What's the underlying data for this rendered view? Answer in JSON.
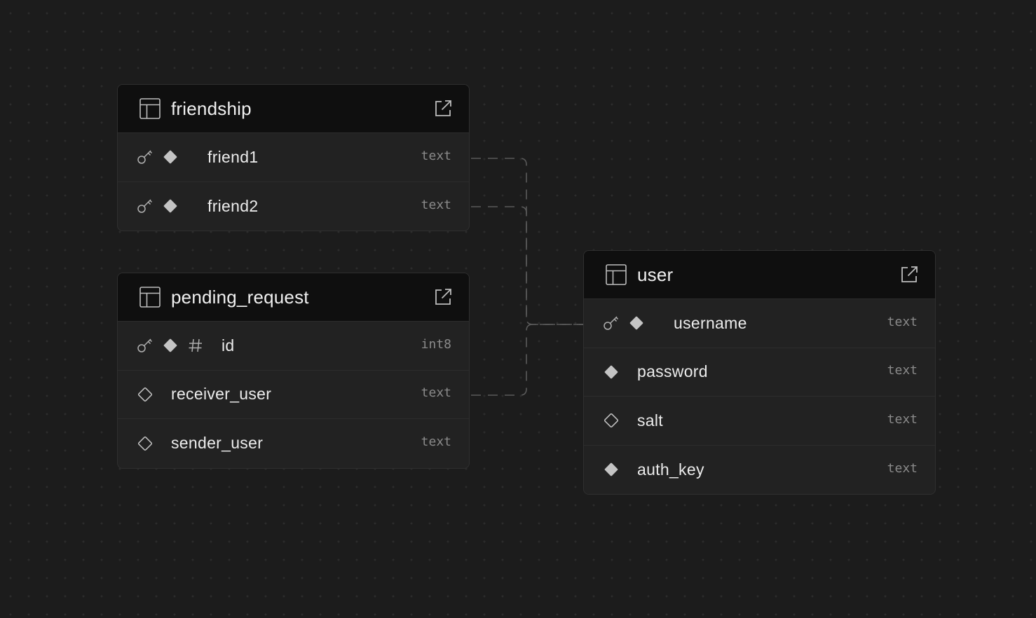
{
  "tables": {
    "friendship": {
      "name": "friendship",
      "columns": [
        {
          "name": "friend1",
          "type": "text"
        },
        {
          "name": "friend2",
          "type": "text"
        }
      ]
    },
    "pending_request": {
      "name": "pending_request",
      "columns": [
        {
          "name": "id",
          "type": "int8"
        },
        {
          "name": "receiver_user",
          "type": "text"
        },
        {
          "name": "sender_user",
          "type": "text"
        }
      ]
    },
    "user": {
      "name": "user",
      "columns": [
        {
          "name": "username",
          "type": "text"
        },
        {
          "name": "password",
          "type": "text"
        },
        {
          "name": "salt",
          "type": "text"
        },
        {
          "name": "auth_key",
          "type": "text"
        }
      ]
    }
  },
  "relations": [
    {
      "from": "friendship.friend1",
      "to": "user.username"
    },
    {
      "from": "friendship.friend2",
      "to": "user.username"
    },
    {
      "from": "pending_request.receiver_user",
      "to": "user.username"
    }
  ],
  "icons": {
    "table": "table-grid-icon",
    "open": "external-link-icon",
    "primary_key": "key-icon",
    "not_null": "diamond-filled-icon",
    "nullable": "diamond-outline-icon",
    "identity": "hash-icon"
  },
  "colors": {
    "canvas": "#1c1c1c",
    "header": "#0f0f0f",
    "row": "#222222",
    "border": "#2f2f2f",
    "edge": "#5a5a5a"
  }
}
